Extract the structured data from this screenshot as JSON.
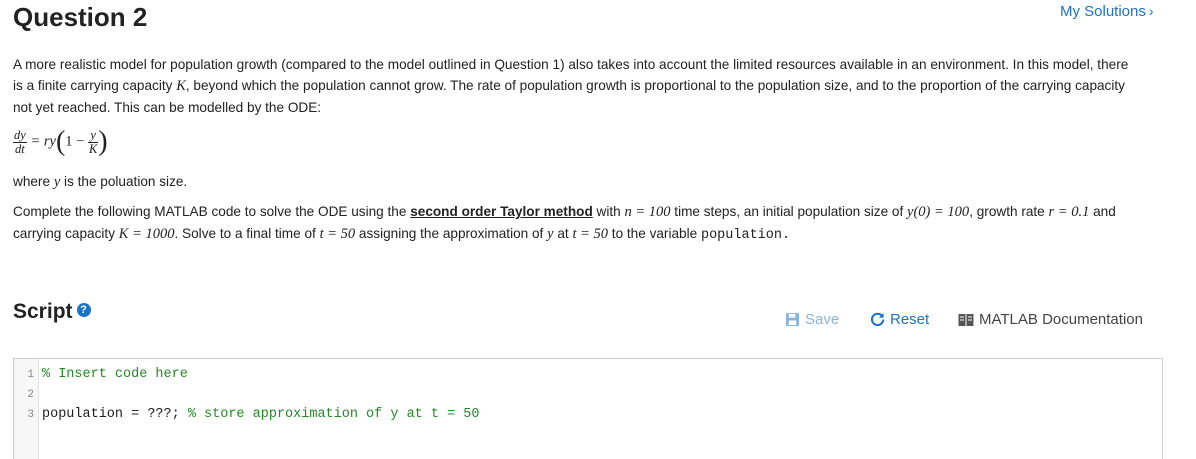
{
  "header": {
    "title": "Question 2",
    "my_solutions_label": "My Solutions",
    "my_solutions_chevron": "›"
  },
  "intro": {
    "part1": "A more realistic model for population growth (compared to the model outlined in Question 1) also takes into account the limited resources available in an environment. In this model, there is a finite carrying capacity ",
    "K": "K",
    "part2": ", beyond which the population cannot grow. The rate of population growth is proportional to the population size, and to the proportion of the carrying capacity not yet reached. This can be modelled by the ODE:"
  },
  "ode": {
    "dy": "dy",
    "dt": "dt",
    "eq": " = ry",
    "lparen": "(",
    "one_minus": "1 − ",
    "y": "y",
    "K": "K",
    "rparen": ")"
  },
  "where": {
    "prefix": "where ",
    "y": "y",
    "suffix": " is the poluation size."
  },
  "task": {
    "part1": "Complete the following MATLAB code to solve the ODE using the ",
    "method": "second order Taylor method",
    "part2": " with ",
    "n_eq": "n = 100",
    "part3": " time steps, an initial population size of ",
    "y0_eq": "y(0) = 100",
    "part4": ", growth rate ",
    "r_eq": "r = 0.1",
    "part5": " and carrying capacity ",
    "K_eq": "K = 1000",
    "part6": ". Solve to a final time of ",
    "t_eq1": "t = 50",
    "part7": " assigning the approximation of ",
    "y": "y",
    "part8": " at ",
    "t_eq2": "t = 50",
    "part9": " to the variable ",
    "var": "population."
  },
  "script": {
    "heading": "Script",
    "help_icon": "question-circle",
    "save_label": "Save",
    "reset_label": "Reset",
    "docs_label": "MATLAB Documentation"
  },
  "editor": {
    "lines": [
      {
        "number": "1",
        "code": "",
        "comment": "% Insert code here"
      },
      {
        "number": "2",
        "code": "",
        "comment": ""
      },
      {
        "number": "3",
        "code": "population = ???; ",
        "comment": "% store approximation of y at t = 50"
      }
    ]
  },
  "colors": {
    "link": "#1a73c7",
    "save_disabled": "#8ab4dc",
    "comment": "#228b22"
  }
}
